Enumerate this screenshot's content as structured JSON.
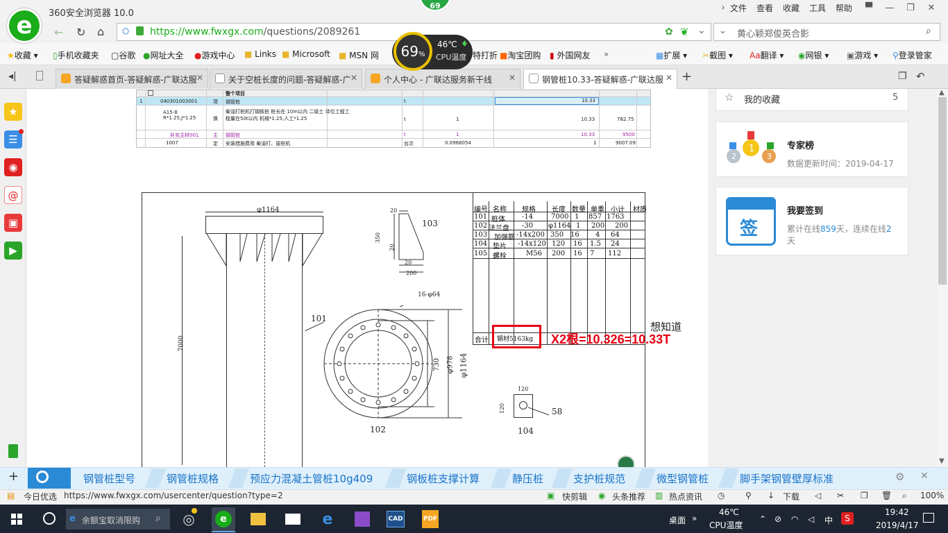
{
  "browser": {
    "app_title": "360安全浏览器 10.0",
    "badge": "69",
    "menu": [
      "文件",
      "查看",
      "收藏",
      "工具",
      "帮助"
    ],
    "address": "https://www.fwxgx.com/questions/2089261",
    "address_host": "https://www.fwxgx.com",
    "address_path": "/questions/2089261",
    "search_text": "黄心颖郑俊英合影",
    "cpu_widget": {
      "percent": "69",
      "percent_unit": "%",
      "temp": "46℃",
      "label": "CPU温度"
    }
  },
  "bookmarks": [
    "收藏",
    "手机收藏夹",
    "谷歌",
    "网址大全",
    "游戏中心",
    "Links",
    "Microsoft",
    "MSN 网",
    "特打折",
    "淘宝团购",
    "外国网友"
  ],
  "bookmarks_right": [
    "扩展",
    "截图",
    "翻译",
    "网银",
    "游戏",
    "登录管家"
  ],
  "tabs": [
    {
      "label": "答疑解惑首页-答疑解惑-广联达服"
    },
    {
      "label": "关于空桩长度的问题-答疑解惑-广"
    },
    {
      "label": "个人中心 - 广联达服务新干线"
    },
    {
      "label": "钢管桩10.33-答疑解惑-广联达服"
    }
  ],
  "sheet": {
    "header": "整个项目",
    "row1": {
      "num": "1",
      "code": "040301003001",
      "type": "项",
      "name": "钢管桩",
      "unit": "t",
      "qty": "10.33"
    },
    "row2": {
      "code": "A15-8\nR*1.25,J*1.25",
      "type": "换",
      "name": "柴油打桩机打钢板桩 桩长在 10m以内 二级土 单位工程工程量在50t以内 机械*1.25,人工*1.25",
      "unit": "t",
      "factor": "1",
      "qty": "10.33",
      "price": "782.75"
    },
    "row3": {
      "code": "补充主材001",
      "type": "主",
      "name": "钢管桩",
      "unit": "t",
      "factor": "1",
      "qty": "10.33",
      "price": "9500"
    },
    "row4": {
      "code": "1007",
      "type": "定",
      "name": "安装措施费用 柴油打、拔桩机",
      "unit": "台次",
      "factor": "0.0968054",
      "qty": "1",
      "price": "9007.09"
    }
  },
  "drawing": {
    "dim_top": "φ1164",
    "dim_height": "7000",
    "label_101": "101",
    "label_102": "102",
    "label_103": "103",
    "label_104": "104",
    "label_58": "58",
    "bolt_holes": "16-φ64",
    "dim_730": "730",
    "dim_978": "φ978",
    "dim_1164b": "φ1164",
    "dim_20a": "20",
    "dim_350": "350",
    "dim_20b": "20",
    "dim_20c": "20",
    "dim_200": "200",
    "dim_120a": "120",
    "dim_120b": "120",
    "table_headers": [
      "编号",
      "名称",
      "规格",
      "长度",
      "数量",
      "单重",
      "小计",
      "材质"
    ],
    "table_rows": [
      [
        "101",
        "桩体",
        "-14",
        "7000",
        "1",
        "857",
        "1763"
      ],
      [
        "102",
        "法兰盘",
        "-30",
        "φ1164",
        "1",
        "200",
        "200"
      ],
      [
        "103",
        "加强筋",
        "-14x200",
        "350",
        "16",
        "4",
        "64"
      ],
      [
        "104",
        "垫片",
        "-14x120",
        "120",
        "16",
        "1.5",
        "24"
      ],
      [
        "105",
        "螺栓",
        "M56",
        "200",
        "16",
        "7",
        "112"
      ]
    ],
    "total_label": "合计",
    "total_value": "钢材5163kg",
    "annotation": "X2根=10.326=10.33T",
    "side_note": "想知道"
  },
  "sidebar_cards": {
    "favorites": {
      "label": "我的收藏",
      "count": "5"
    },
    "experts": {
      "title": "专家榜",
      "subtitle": "数据更新时间：2019-04-17"
    },
    "signin": {
      "title": "我要签到",
      "icon_text": "签",
      "line1_prefix": "累计在线",
      "days": "859",
      "line1_suffix": "天，连续在线",
      "streak": "2",
      "line2": "天"
    }
  },
  "related_searches": [
    "钢管桩型号",
    "钢管桩规格",
    "预应力混凝土管桩10g409",
    "钢板桩支撑计算",
    "静压桩",
    "支护桩规范",
    "微型钢管桩",
    "脚手架钢管壁厚标准"
  ],
  "status": {
    "today": "今日优选",
    "url": "https://www.fwxgx.com/usercenter/question?type=2",
    "items": [
      "快剪辑",
      "头条推荐",
      "热点资讯",
      "下载"
    ],
    "zoom": "100%"
  },
  "taskbar": {
    "search_text": "余额宝取消限购",
    "desktop": "桌面",
    "temp": "46℃",
    "temp_label": "CPU温度",
    "ime": "中",
    "time": "19:42",
    "date": "2019/4/17",
    "app_cad": "CAD",
    "app_pdf": "PDF"
  },
  "colors": {
    "accent": "#1aad19",
    "link": "#1a73c8",
    "red": "#e60012",
    "sheet_sel": "#bfe6f5"
  }
}
